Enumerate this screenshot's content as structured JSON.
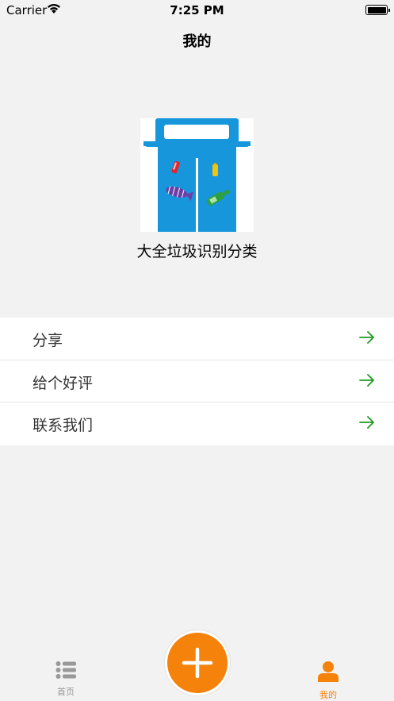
{
  "status_bar": {
    "carrier": "Carrier",
    "time": "7:25 PM"
  },
  "nav": {
    "title": "我的"
  },
  "app": {
    "name": "大全垃圾识别分类"
  },
  "menu": {
    "items": [
      {
        "label": "分享"
      },
      {
        "label": "给个好评"
      },
      {
        "label": "联系我们"
      }
    ]
  },
  "tabs": [
    {
      "label": "首页",
      "icon": "list-icon"
    },
    {
      "label": "我的",
      "icon": "person-icon"
    }
  ],
  "colors": {
    "accent": "#f5820a",
    "arrow": "#1e9a1e",
    "bin": "#1796dc"
  }
}
